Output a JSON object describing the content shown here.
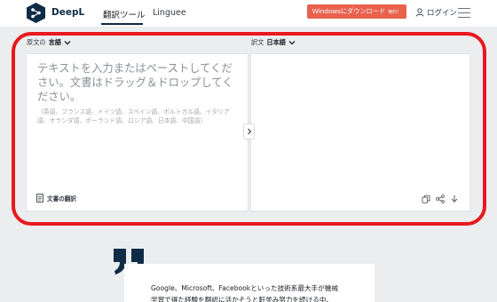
{
  "header": {
    "brand": "DeepL",
    "tabs": [
      {
        "label": "翻訳ツール",
        "active": true
      },
      {
        "label": "Linguee",
        "active": false
      }
    ],
    "download_button": {
      "label": "Windowsにダウンロード",
      "badge": "無料！"
    },
    "login_label": "ログイン",
    "icons": [
      "deepl-logo",
      "user-icon",
      "hamburger-menu-icon"
    ]
  },
  "source": {
    "lang_prefix": "原文の",
    "lang_value": "言語",
    "placeholder": "テキストを入力またはペーストしてください。文書はドラッグ＆ドロップしてください。",
    "languages_hint": "（英語、フランス語、ドイツ語、スペイン語、ポルトガル語、イタリア語、オランダ語、ポーランド語、ロシア語、日本語、中国語）",
    "doc_translate_label": "文書の翻訳"
  },
  "target": {
    "lang_prefix": "訳文",
    "lang_value": "日本語",
    "actions": [
      "copy-icon",
      "share-icon",
      "download-icon"
    ]
  },
  "testimonial": {
    "line1": "Google、Microsoft、Facebookといった技術系最大手が機械",
    "line2": "学習で得た経験を翻訳に活かそうと軒並み努力を続ける中、"
  },
  "colors": {
    "brand_navy": "#0f2b46",
    "download_orange": "#e9614d",
    "highlight_red": "#e8181e",
    "page_bg": "#ecedef"
  }
}
